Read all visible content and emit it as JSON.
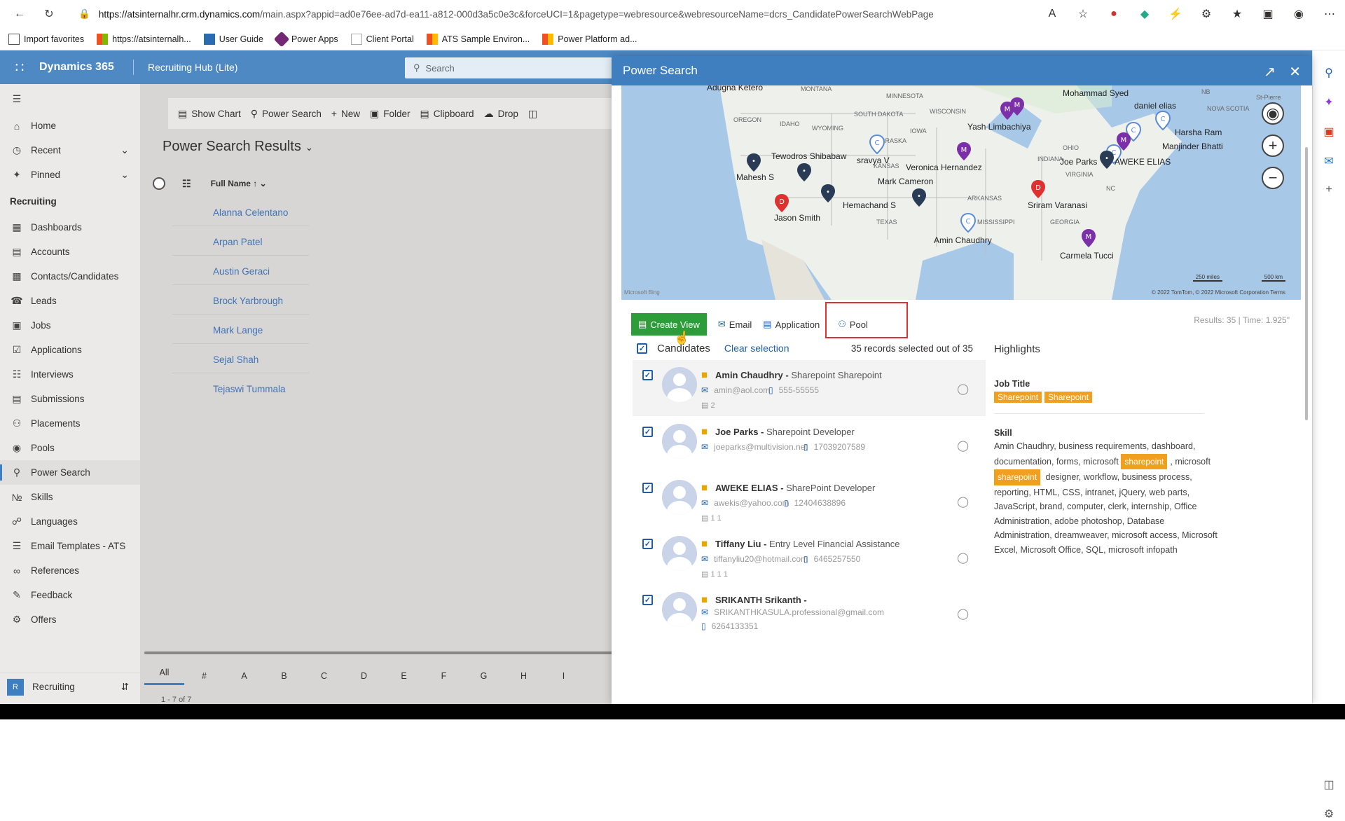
{
  "browser": {
    "url_host": "https://atsinternalhr.crm.dynamics.com",
    "url_rest": "/main.aspx?appid=ad0e76ee-ad7d-ea11-a812-000d3a5c0e3c&forceUCI=1&pagetype=webresource&webresourceName=dcrs_CandidatePowerSearchWebPage",
    "favorites": [
      "Import favorites",
      "https://atsinternalh...",
      "User Guide",
      "Power Apps",
      "Client Portal",
      "ATS Sample Environ...",
      "Power Platform ad..."
    ]
  },
  "d365": {
    "app_name": "Dynamics 365",
    "hub_name": "Recruiting Hub (Lite)",
    "search_placeholder": "Search"
  },
  "sidebar": {
    "top_items": [
      {
        "label": "Home",
        "icon": "home-icon"
      },
      {
        "label": "Recent",
        "icon": "clock-icon"
      },
      {
        "label": "Pinned",
        "icon": "pin-icon"
      }
    ],
    "group": "Recruiting",
    "items": [
      {
        "label": "Dashboards"
      },
      {
        "label": "Accounts"
      },
      {
        "label": "Contacts/Candidates"
      },
      {
        "label": "Leads"
      },
      {
        "label": "Jobs"
      },
      {
        "label": "Applications"
      },
      {
        "label": "Interviews"
      },
      {
        "label": "Submissions"
      },
      {
        "label": "Placements"
      },
      {
        "label": "Pools"
      },
      {
        "label": "Power Search"
      },
      {
        "label": "Skills"
      },
      {
        "label": "Languages"
      },
      {
        "label": "Email Templates - ATS"
      },
      {
        "label": "References"
      },
      {
        "label": "Feedback"
      },
      {
        "label": "Offers"
      }
    ],
    "area_badge": "R",
    "area_label": "Recruiting"
  },
  "main": {
    "commands": [
      "Show Chart",
      "Power Search",
      "New",
      "Folder",
      "Clipboard",
      "Drop"
    ],
    "view_title": "Power Search Results",
    "column_header": "Full Name",
    "rows": [
      "Alanna Celentano",
      "Arpan Patel",
      "Austin Geraci",
      "Brock Yarbrough",
      "Mark Lange",
      "Sejal Shah",
      "Tejaswi Tummala"
    ],
    "alpha": [
      "All",
      "#",
      "A",
      "B",
      "C",
      "D",
      "E",
      "F",
      "G",
      "H",
      "I"
    ],
    "paging": "1 - 7 of 7"
  },
  "modal": {
    "title": "Power Search",
    "map": {
      "pins": [
        {
          "label": "Mohammad Syed",
          "color": "#7b2fa8",
          "letter": "M"
        },
        {
          "label": "daniel elias",
          "color": "#5b8ad8",
          "letter": "C"
        },
        {
          "label": "Yash Limbachiya",
          "color": "#7b2fa8",
          "letter": "M"
        },
        {
          "label": "Harsha Ram",
          "color": "#5b8ad8",
          "letter": "C"
        },
        {
          "label": "Manjinder Bhatti",
          "color": "#7b2fa8",
          "letter": "M"
        },
        {
          "label": "Joe Parks",
          "color": "#5b8ad8",
          "letter": "C"
        },
        {
          "label": "AWEKE ELIAS",
          "color": "#2a3b55",
          "letter": "•"
        },
        {
          "label": "Tewodros Shibabaw",
          "color": "#2a3b55",
          "letter": "•"
        },
        {
          "label": "Mahesh S",
          "color": "#2a3b55",
          "letter": "•"
        },
        {
          "label": "sravya V",
          "color": "#5b8ad8",
          "letter": "C"
        },
        {
          "label": "Veronica Hernandez",
          "color": "#7b2fa8",
          "letter": "M"
        },
        {
          "label": "Mark Cameron",
          "color": "#2a3b55",
          "letter": "•"
        },
        {
          "label": "Hemachand S",
          "color": "#2a3b55",
          "letter": "•"
        },
        {
          "label": "Sriram Varanasi",
          "color": "#e03030",
          "letter": "D"
        },
        {
          "label": "Jason Smith",
          "color": "#e03030",
          "letter": "D"
        },
        {
          "label": "Amin Chaudhry",
          "color": "#5b8ad8",
          "letter": "C"
        },
        {
          "label": "Carmela Tucci",
          "color": "#7b2fa8",
          "letter": "M"
        },
        {
          "label": "Adugna Ketero",
          "color": "",
          "letter": ""
        }
      ],
      "states": [
        "MONTANA",
        "MINNESOTA",
        "WISCONSIN",
        "SOUTH DAKOTA",
        "OREGON",
        "IDAHO",
        "WYOMING",
        "IOWA",
        "NEBRASKA",
        "OHIO",
        "INDIANA",
        "KANSAS",
        "VIRGINIA",
        "NC",
        "ARKANSAS",
        "TEXAS",
        "MISSISSIPPI",
        "GEORGIA",
        "NB",
        "NOVA SCOTIA",
        "St-Pierre"
      ],
      "copyright": "© 2022 TomTom, © 2022 Microsoft Corporation Terms",
      "scale_miles": "250 miles",
      "scale_km": "500 km",
      "brand": "Microsoft Bing"
    },
    "toolbar": {
      "create_view": "Create View",
      "email": "Email",
      "application": "Application",
      "pool": "Pool"
    },
    "results_info": "Results: 35 | Time: 1.925\"",
    "list": {
      "heading": "Candidates",
      "clear": "Clear selection",
      "count": "35 records selected out of 35"
    },
    "candidates": [
      {
        "name": "Amin Chaudhry",
        "title": "Sharepoint Sharepoint",
        "email": "amin@aol.com",
        "phone": "555-55555",
        "meta": "2"
      },
      {
        "name": "Joe Parks",
        "title": "Sharepoint Developer",
        "email": "joeparks@multivision.net",
        "phone": "17039207589",
        "meta": ""
      },
      {
        "name": "AWEKE ELIAS",
        "title": "SharePoint Developer",
        "email": "awekis@yahoo.com",
        "phone": "12404638896",
        "meta": "1      1"
      },
      {
        "name": "Tiffany Liu",
        "title": "Entry Level Financial Assistance",
        "email": "tiffanyliu20@hotmail.com",
        "phone": "6465257550",
        "meta": "1      1      1"
      },
      {
        "name": "SRIKANTH Srikanth",
        "title": "",
        "email": "SRIKANTHKASULA.professional@gmail.com",
        "phone": "6264133351",
        "meta": ""
      }
    ],
    "highlights": {
      "heading": "Highlights",
      "job_title_label": "Job Title",
      "job_title_tags": [
        "Sharepoint",
        "Sharepoint"
      ],
      "skill_label": "Skill",
      "skill_text_1": "Amin Chaudhry, business requirements, dashboard, documentation, forms, microsoft",
      "skill_tag_1": "sharepoint",
      "skill_mid": "microsoft",
      "skill_tag_2": "sharepoint",
      "skill_text_2": "designer, workflow, business process, reporting, HTML, CSS, intranet, jQuery, web parts, JavaScript, brand, computer, clerk, internship, Office Administration, adobe photoshop, Database Administration, dreamweaver, microsoft access, Microsoft Excel, Microsoft Office, SQL, microsoft infopath"
    }
  }
}
